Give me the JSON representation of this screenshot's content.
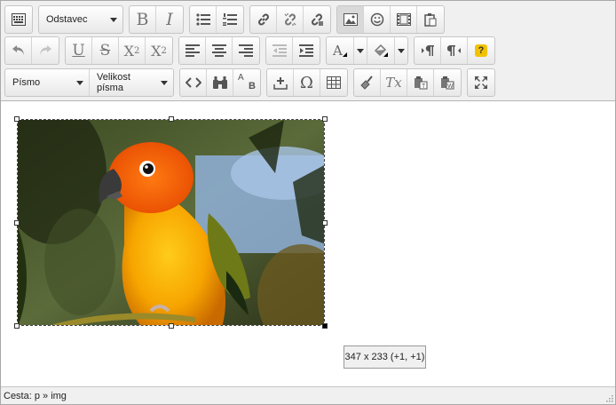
{
  "toolbar": {
    "format_select": "Odstavec",
    "font_select": "Písmo",
    "size_select": "Velikost písma",
    "bold_label": "B",
    "italic_label": "I",
    "underline_label": "U",
    "strike_label": "S",
    "subscript_label": "X2",
    "superscript_label": "X2",
    "help_label": "?",
    "replace_label_a": "A",
    "replace_label_b": "B",
    "omega_label": "Ω",
    "clearformat_label": "Tx"
  },
  "content": {
    "image_name": "parrot-image",
    "resize_tooltip": "347 x 233 (+1, +1)"
  },
  "statusbar": {
    "path": "Cesta: p » img"
  },
  "colors": {
    "accent_help": "#f2c200",
    "toolbar_bg": "#f0f0f0"
  }
}
